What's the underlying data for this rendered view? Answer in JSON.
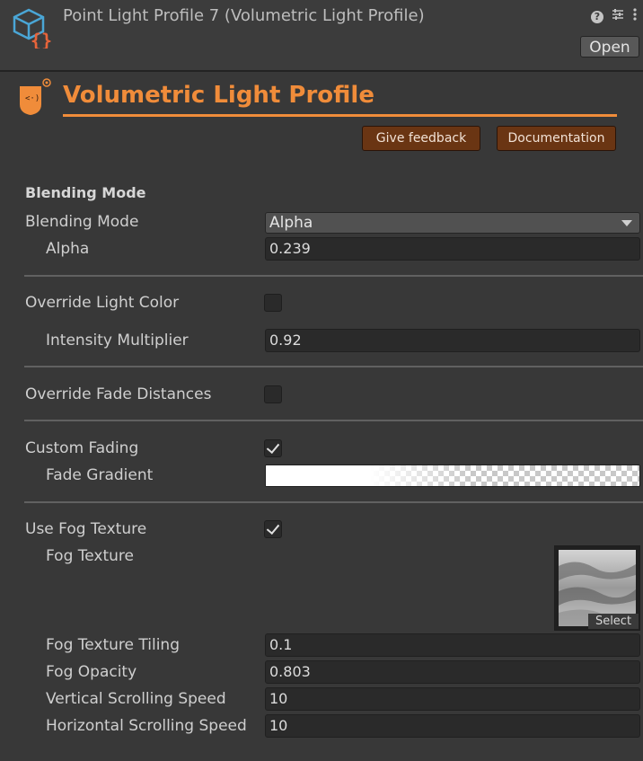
{
  "window": {
    "title": "Point Light Profile 7 (Volumetric Light Profile)",
    "open_label": "Open",
    "help_glyph": "?"
  },
  "profile": {
    "title": "Volumetric Light Profile",
    "give_feedback": "Give feedback",
    "documentation": "Documentation",
    "accent_color": "#f08c3a",
    "button_color": "#6a3513"
  },
  "blending": {
    "section_title": "Blending Mode",
    "mode_label": "Blending Mode",
    "mode_value": "Alpha",
    "alpha_label": "Alpha",
    "alpha_value": "0.239"
  },
  "light_color": {
    "override_label": "Override Light Color",
    "override_checked": false,
    "intensity_label": "Intensity Multiplier",
    "intensity_value": "0.92"
  },
  "fade_distances": {
    "override_label": "Override Fade Distances",
    "override_checked": false
  },
  "custom_fading": {
    "label": "Custom Fading",
    "checked": true,
    "gradient_label": "Fade Gradient"
  },
  "fog": {
    "use_label": "Use Fog Texture",
    "use_checked": true,
    "texture_label": "Fog Texture",
    "select_label": "Select",
    "tiling_label": "Fog Texture Tiling",
    "tiling_value": "0.1",
    "opacity_label": "Fog Opacity",
    "opacity_value": "0.803",
    "vertical_label": "Vertical Scrolling Speed",
    "vertical_value": "10",
    "horizontal_label": "Horizontal Scrolling Speed",
    "horizontal_value": "10"
  }
}
